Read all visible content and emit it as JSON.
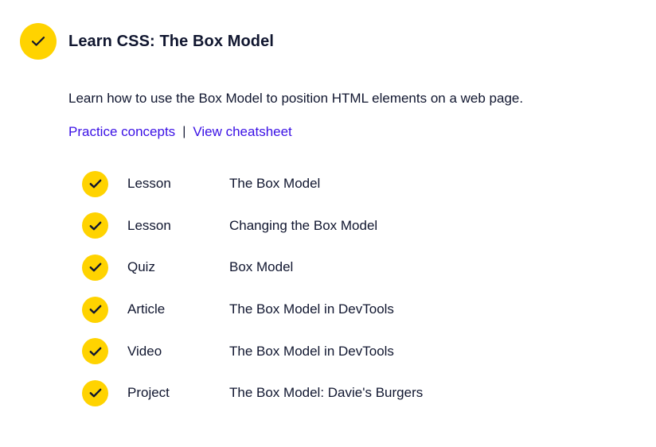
{
  "module": {
    "title": "Learn CSS: The Box Model",
    "status_icon": "check-icon",
    "description": "Learn how to use the Box Model to position HTML elements on a web page.",
    "links": {
      "practice": "Practice concepts",
      "separator": "|",
      "cheatsheet": "View cheatsheet"
    },
    "items": [
      {
        "type": "Lesson",
        "title": "The Box Model",
        "completed": true
      },
      {
        "type": "Lesson",
        "title": "Changing the Box Model",
        "completed": true
      },
      {
        "type": "Quiz",
        "title": "Box Model",
        "completed": true
      },
      {
        "type": "Article",
        "title": "The Box Model in DevTools",
        "completed": true
      },
      {
        "type": "Video",
        "title": "The Box Model in DevTools",
        "completed": true
      },
      {
        "type": "Project",
        "title": "The Box Model: Davie's Burgers",
        "completed": true
      }
    ]
  },
  "colors": {
    "check_yellow": "#ffd300",
    "link_purple": "#3a10e5",
    "text_navy": "#10162f"
  }
}
